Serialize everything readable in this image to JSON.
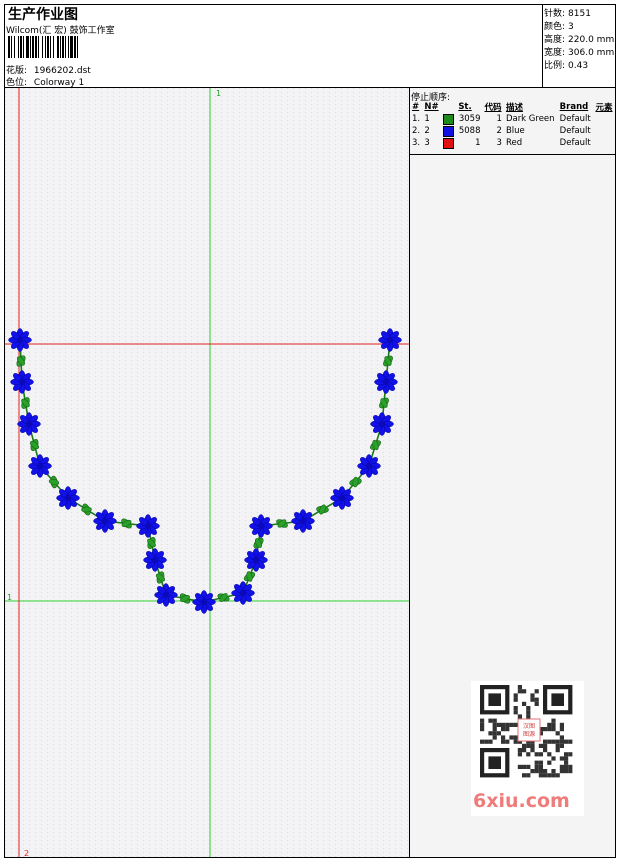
{
  "header": {
    "title": "生产作业图",
    "subtitle": "Wilcom(汇 宏) 鼓饰工作室",
    "design_label": "花版:",
    "design_value": "1966202.dst",
    "colorway_label": "色位:",
    "colorway_value": "Colorway 1"
  },
  "stats": [
    {
      "label": "针数:",
      "value": "8151"
    },
    {
      "label": "颜色:",
      "value": "3"
    },
    {
      "label": "高度:",
      "value": "220.0 mm"
    },
    {
      "label": "宽度:",
      "value": "306.0 mm"
    },
    {
      "label": "比例:",
      "value": "0.43"
    }
  ],
  "stop_sequence": {
    "title": "停止顺序:",
    "columns": [
      "#",
      "N#",
      "St.",
      "代码",
      "描述",
      "Brand",
      "元素"
    ],
    "rows": [
      {
        "idx": "1.",
        "n": "1",
        "color": "#1b8a1b",
        "st": "3059",
        "code": "1",
        "desc": "Dark Green",
        "brand": "Default"
      },
      {
        "idx": "2.",
        "n": "2",
        "color": "#1010e0",
        "st": "5088",
        "code": "2",
        "desc": "Blue",
        "brand": "Default"
      },
      {
        "idx": "3.",
        "n": "3",
        "color": "#e01010",
        "st": "1",
        "code": "3",
        "desc": "Red",
        "brand": "Default"
      }
    ]
  },
  "canvas": {
    "marker_top": "1",
    "marker_left": "1",
    "marker_bottom": "2",
    "guide_green": "#2fd12f",
    "guide_red": "#e02020",
    "flower_color": "#1212e8",
    "leaf_color": "#2aa02a"
  },
  "watermark": {
    "text": "6xiu.com",
    "qr_badge": "汉图图源"
  }
}
